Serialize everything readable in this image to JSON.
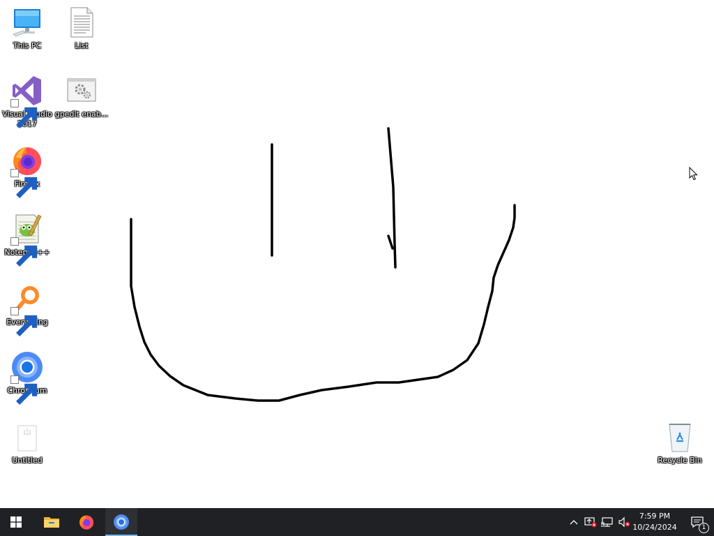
{
  "desktop": {
    "icons": {
      "this_pc": {
        "label": "This PC",
        "icon": "computer-icon"
      },
      "list": {
        "label": "List",
        "icon": "text-file-icon"
      },
      "visual_studio": {
        "label": "Visual Studio 2017",
        "icon": "visual-studio-icon"
      },
      "gpedit": {
        "label": "gpedit enab...",
        "icon": "batch-file-icon"
      },
      "firefox": {
        "label": "Firefox",
        "icon": "firefox-icon"
      },
      "notepadpp": {
        "label": "Notepad++",
        "icon": "notepad-plus-plus-icon"
      },
      "everything": {
        "label": "Everything",
        "icon": "everything-search-icon"
      },
      "chromium": {
        "label": "Chromium",
        "icon": "chromium-icon"
      },
      "untitled": {
        "label": "Untitled",
        "icon": "blank-document-icon"
      },
      "recycle_bin": {
        "label": "Recycle Bin",
        "icon": "recycle-bin-icon"
      }
    }
  },
  "drawing": {
    "stroke_color": "#000000",
    "description_icon": "pen-stroke"
  },
  "taskbar": {
    "background": "#202124",
    "start": {
      "icon": "windows-logo-icon"
    },
    "pinned": [
      {
        "name": "File Explorer",
        "icon": "folder-icon"
      },
      {
        "name": "Firefox",
        "icon": "firefox-icon"
      },
      {
        "name": "Chromium",
        "icon": "chromium-icon",
        "active": true
      }
    ],
    "tray": {
      "icons": [
        "chevron-up-icon",
        "security-icon",
        "network-icon",
        "volume-muted-icon"
      ],
      "time": "7:59 PM",
      "date": "10/24/2024",
      "notification_count": "1"
    }
  }
}
